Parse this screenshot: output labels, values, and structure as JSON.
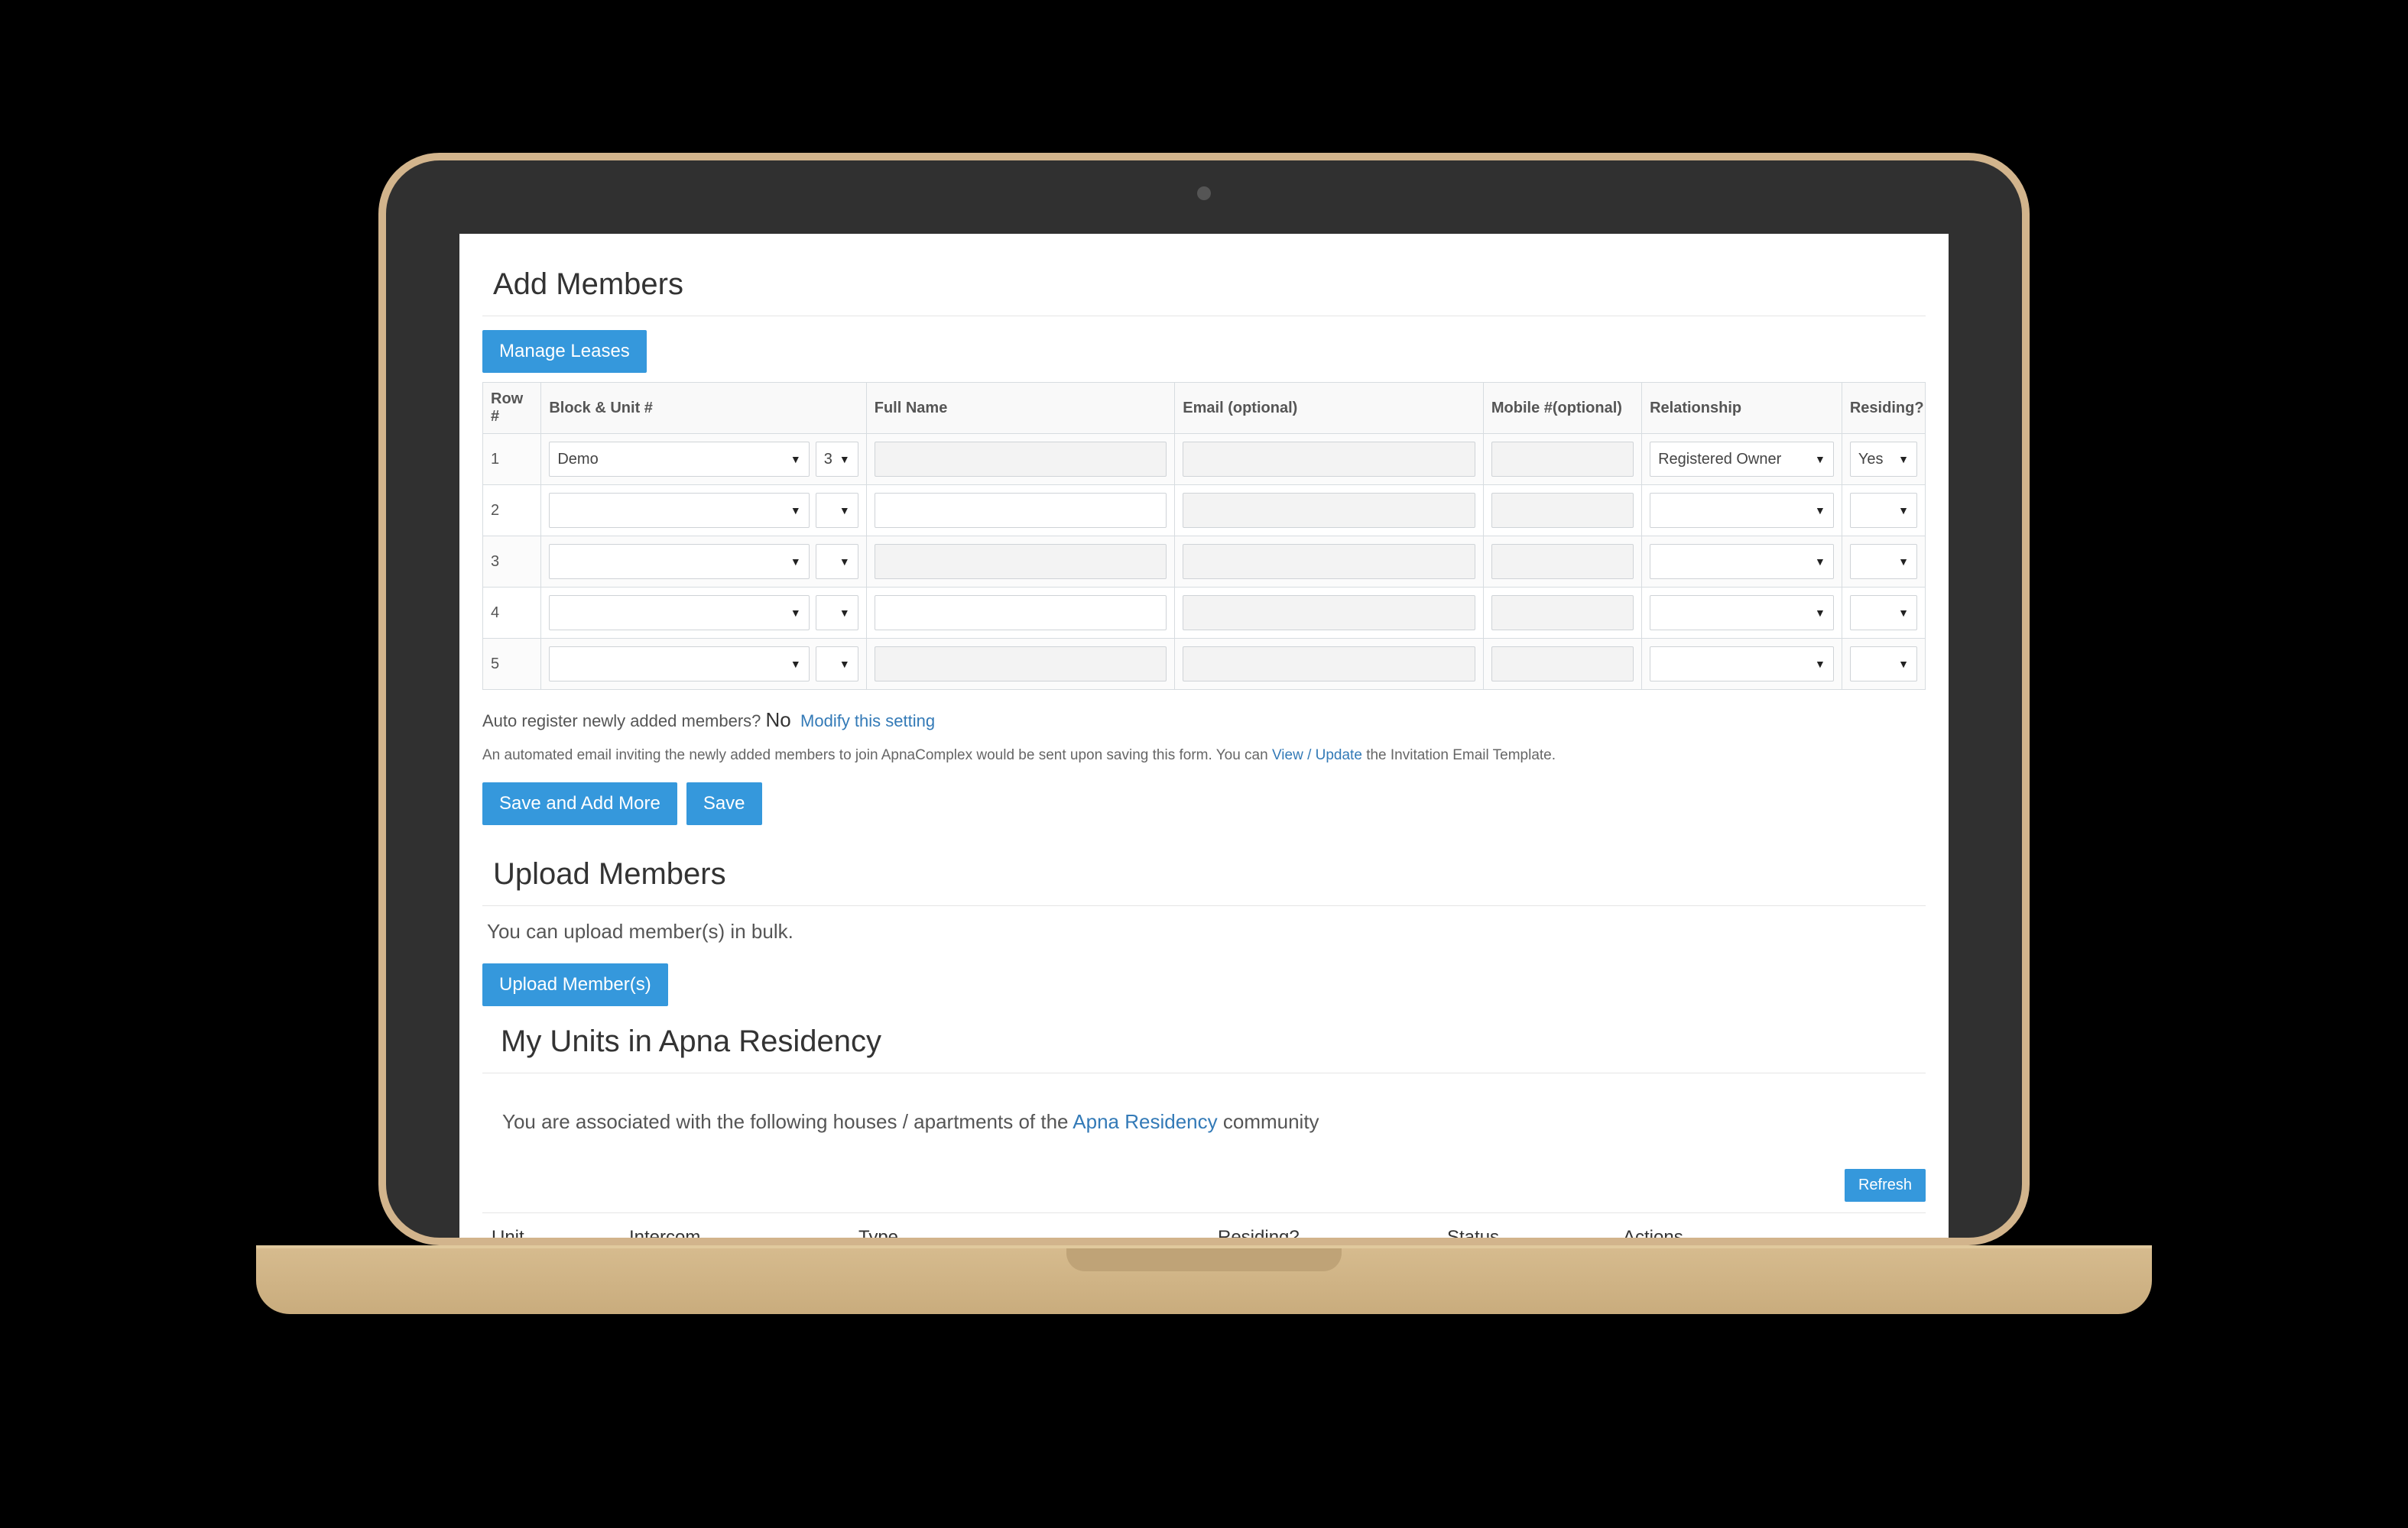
{
  "addMembers": {
    "title": "Add Members",
    "manage_leases_label": "Manage Leases",
    "headers": {
      "row": "Row #",
      "block_unit": "Block & Unit #",
      "full_name": "Full Name",
      "email": "Email (optional)",
      "mobile": "Mobile #(optional)",
      "relationship": "Relationship",
      "residing": "Residing?"
    },
    "rows": [
      {
        "n": "1",
        "block": "Demo",
        "unit": "3",
        "name": "",
        "email": "",
        "mobile": "",
        "relationship": "Registered Owner",
        "residing": "Yes",
        "name_readonly": true
      },
      {
        "n": "2",
        "block": "",
        "unit": "",
        "name": "",
        "email": "",
        "mobile": "",
        "relationship": "",
        "residing": "",
        "name_readonly": false
      },
      {
        "n": "3",
        "block": "",
        "unit": "",
        "name": "",
        "email": "",
        "mobile": "",
        "relationship": "",
        "residing": "",
        "name_readonly": true
      },
      {
        "n": "4",
        "block": "",
        "unit": "",
        "name": "",
        "email": "",
        "mobile": "",
        "relationship": "",
        "residing": "",
        "name_readonly": false
      },
      {
        "n": "5",
        "block": "",
        "unit": "",
        "name": "",
        "email": "",
        "mobile": "",
        "relationship": "",
        "residing": "",
        "name_readonly": true
      }
    ],
    "auto_register_prefix": "Auto register newly added members? ",
    "auto_register_answer": "No",
    "auto_register_link": "Modify this setting",
    "invitation_prefix": "An automated email inviting the newly added members to join ApnaComplex would be sent upon saving this form. You can ",
    "invitation_link": "View / Update",
    "invitation_suffix": " the Invitation Email Template.",
    "save_add_more_label": "Save and Add More",
    "save_label": "Save"
  },
  "uploadMembers": {
    "title": "Upload Members",
    "description": "You can upload member(s) in bulk.",
    "button_label": "Upload Member(s)"
  },
  "myUnits": {
    "title": "My Units in Apna Residency",
    "intro_prefix": "You are associated with the following houses / apartments of the ",
    "intro_link": "Apna Residency",
    "intro_suffix": " community",
    "refresh_label": "Refresh",
    "headers": {
      "unit": "Unit",
      "intercom": "Intercom",
      "type": "Type",
      "residing": "Residing?",
      "status": "Status",
      "actions": "Actions"
    }
  }
}
